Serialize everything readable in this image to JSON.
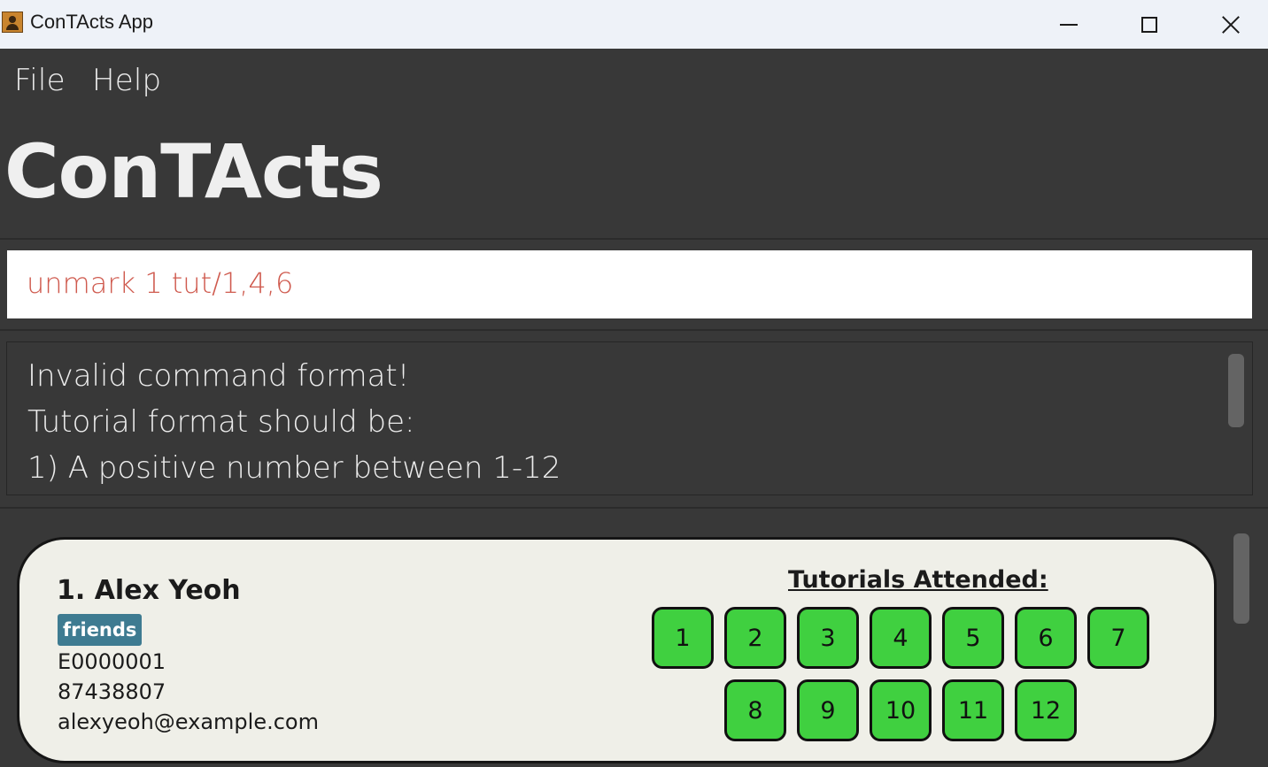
{
  "window": {
    "title": "ConTActs App",
    "icon": "contacts-app-icon"
  },
  "menu": {
    "items": [
      "File",
      "Help"
    ]
  },
  "heading": "ConTActs",
  "command": {
    "value": "unmark 1 tut/1,4,6"
  },
  "result": {
    "lines": [
      "Invalid command format!",
      "Tutorial format should be:",
      "1) A positive number between 1-12"
    ]
  },
  "contacts": [
    {
      "name": "1. Alex Yeoh",
      "tag": "friends",
      "student_id": "E0000001",
      "phone": "87438807",
      "email": "alexyeoh@example.com",
      "tutorials_title": "Tutorials Attended:",
      "tutorials": [
        "1",
        "2",
        "3",
        "4",
        "5",
        "6",
        "7",
        "8",
        "9",
        "10",
        "11",
        "12"
      ]
    }
  ],
  "colors": {
    "tutorial_box": "#40d040",
    "tag": "#3e7b91",
    "command_text": "#cf5a4e",
    "background": "#383838",
    "card": "#efefe8"
  }
}
